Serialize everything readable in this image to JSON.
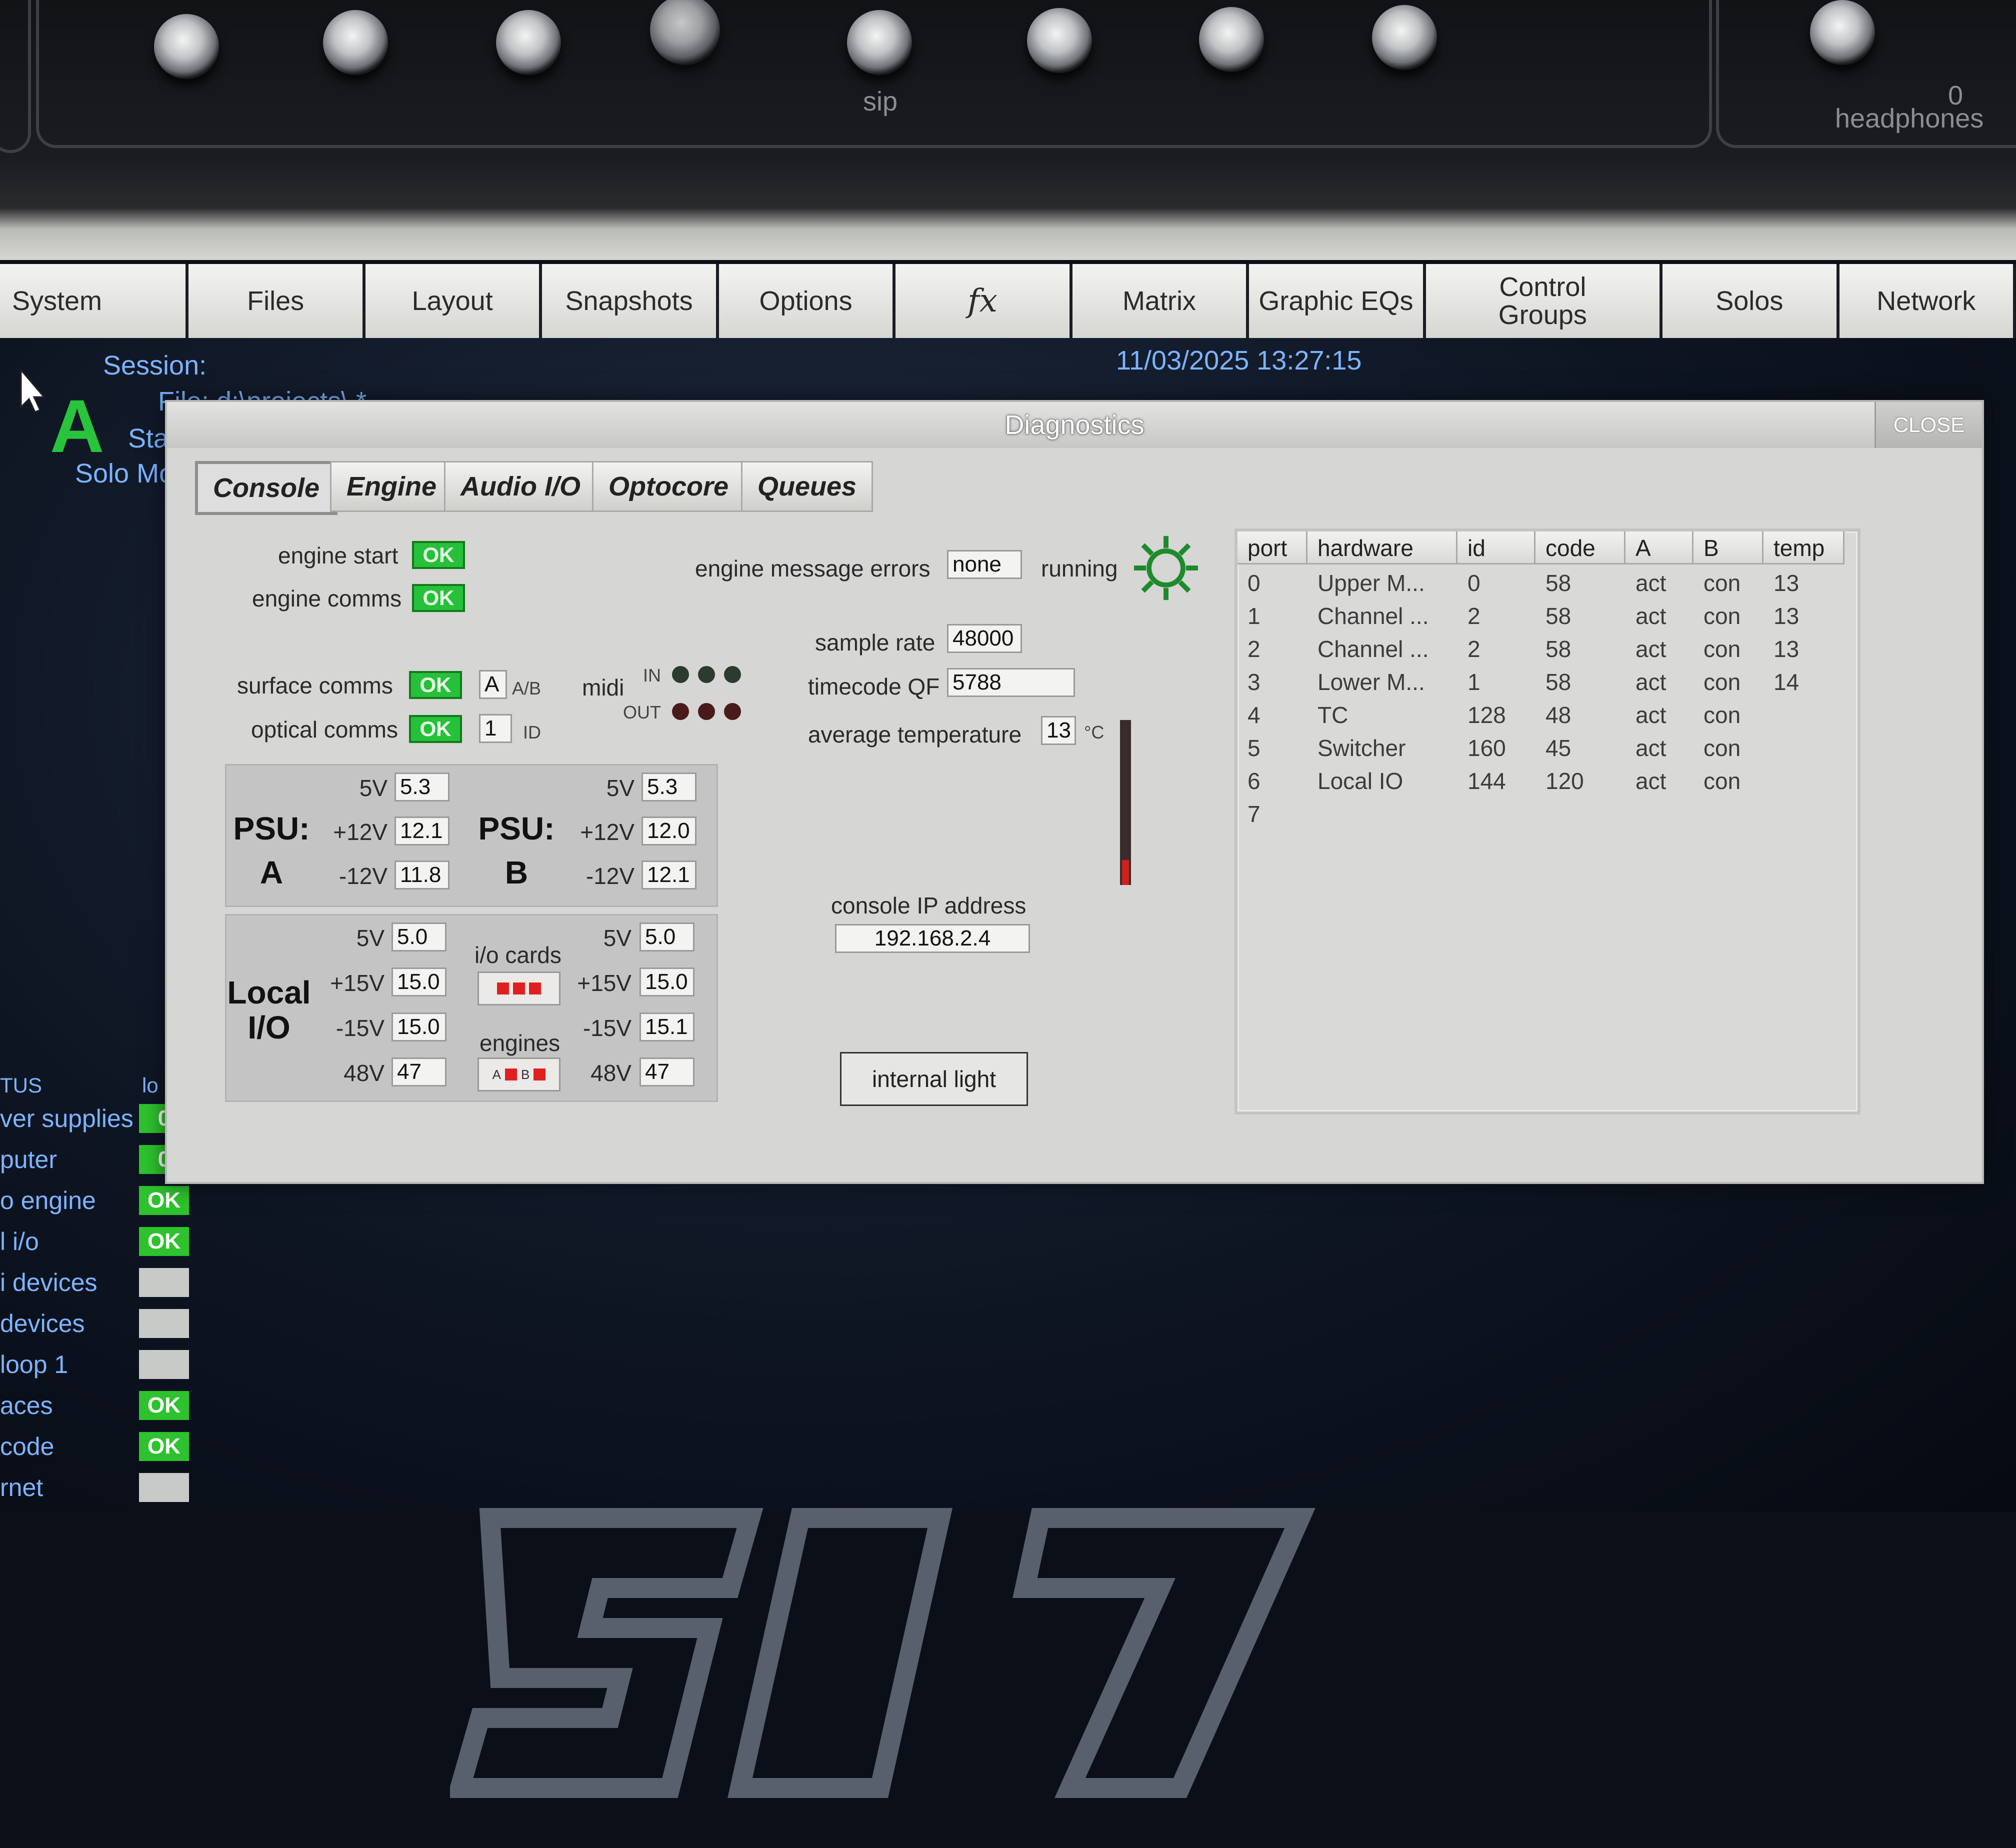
{
  "hardware": {
    "sip_label": "sip",
    "headphones_label": "headphones",
    "headphones_scale": "0"
  },
  "toolbar": {
    "tabs": [
      "System",
      "Files",
      "Layout",
      "Snapshots",
      "Options",
      "fx",
      "Matrix",
      "Graphic EQs",
      "Control Groups",
      "Solos",
      "Network"
    ]
  },
  "background": {
    "session_label": "Session:",
    "file_label": "File: d:\\projects\\ *",
    "status_label": "Statu",
    "solo_mode_label": "Solo Mod",
    "console_letter": "A",
    "datetime": "11/03/2025 13:27:15",
    "status_header": "TUS",
    "status_header_right": "lo",
    "status_rows": [
      {
        "label": "ver supplies",
        "value": "0"
      },
      {
        "label": "puter",
        "value": "0"
      },
      {
        "label": "o engine",
        "value": "OK"
      },
      {
        "label": "l i/o",
        "value": "OK"
      },
      {
        "label": "i devices",
        "value": ""
      },
      {
        "label": " devices",
        "value": ""
      },
      {
        "label": " loop 1",
        "value": ""
      },
      {
        "label": "aces",
        "value": "OK"
      },
      {
        "label": "code",
        "value": "OK"
      },
      {
        "label": "rnet",
        "value": ""
      }
    ]
  },
  "dialog": {
    "title": "Diagnostics",
    "close_label": "CLOSE",
    "tabs": [
      "Console",
      "Engine",
      "Audio I/O",
      "Optocore",
      "Queues"
    ],
    "engine_start_label": "engine start",
    "engine_start_status": "OK",
    "engine_comms_label": "engine comms",
    "engine_comms_status": "OK",
    "surface_comms_label": "surface comms",
    "surface_comms_status": "OK",
    "optical_comms_label": "optical comms",
    "optical_comms_status": "OK",
    "ab_value": "A",
    "ab_label": "A/B",
    "id_value": "1",
    "id_label": "ID",
    "midi_label": "midi",
    "midi_in_label": "IN",
    "midi_out_label": "OUT",
    "engine_msg_errors_label": "engine message errors",
    "engine_msg_errors_value": "none",
    "running_label": "running",
    "sample_rate_label": "sample rate",
    "sample_rate_value": "48000",
    "timecode_label": "timecode QF",
    "timecode_value": "5788",
    "avg_temp_label": "average temperature",
    "avg_temp_value": "13",
    "temp_unit": "°C",
    "console_ip_label": "console IP address",
    "console_ip_value": "192.168.2.4",
    "internal_light_label": "internal light",
    "psu_a": {
      "title": "PSU:",
      "letter": "A",
      "v5_label": "5V",
      "v5": "5.3",
      "v12p_label": "+12V",
      "v12p": "12.1",
      "v12n_label": "-12V",
      "v12n": "11.8"
    },
    "psu_b": {
      "title": "PSU:",
      "letter": "B",
      "v5_label": "5V",
      "v5": "5.3",
      "v12p_label": "+12V",
      "v12p": "12.0",
      "v12n_label": "-12V",
      "v12n": "12.1"
    },
    "local_io": {
      "title_line1": "Local",
      "title_line2": "I/O",
      "io_cards_label": "i/o cards",
      "engines_label": "engines",
      "engine_a_label": "A",
      "engine_b_label": "B",
      "left": {
        "v5_label": "5V",
        "v5": "5.0",
        "v15p_label": "+15V",
        "v15p": "15.0",
        "v15n_label": "-15V",
        "v15n": "15.0",
        "v48_label": "48V",
        "v48": "47"
      },
      "right": {
        "v5_label": "5V",
        "v5": "5.0",
        "v15p_label": "+15V",
        "v15p": "15.0",
        "v15n_label": "-15V",
        "v15n": "15.1",
        "v48_label": "48V",
        "v48": "47"
      }
    },
    "table": {
      "headers": [
        "port",
        "hardware",
        "id",
        "code",
        "A",
        "B",
        "temp"
      ],
      "rows": [
        [
          "0",
          "Upper M...",
          "0",
          "58",
          "act",
          "con",
          "13"
        ],
        [
          "1",
          "Channel ...",
          "2",
          "58",
          "act",
          "con",
          "13"
        ],
        [
          "2",
          "Channel ...",
          "2",
          "58",
          "act",
          "con",
          "13"
        ],
        [
          "3",
          "Lower M...",
          "1",
          "58",
          "act",
          "con",
          "14"
        ],
        [
          "4",
          "TC",
          "128",
          "48",
          "act",
          "con",
          ""
        ],
        [
          "5",
          "Switcher",
          "160",
          "45",
          "act",
          "con",
          ""
        ],
        [
          "6",
          "Local IO",
          "144",
          "120",
          "act",
          "con",
          ""
        ],
        [
          "7",
          "",
          "",
          "",
          "",
          "",
          ""
        ]
      ]
    }
  }
}
